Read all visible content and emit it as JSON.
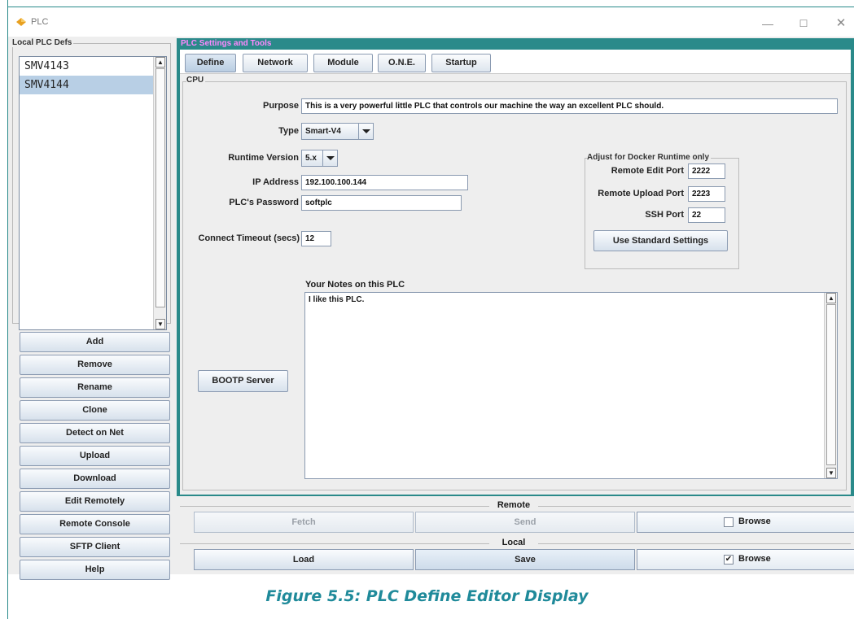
{
  "window": {
    "title": "PLC",
    "icon": "plc-app-icon",
    "controls": {
      "minimize": "—",
      "maximize": "☐",
      "close": "✕"
    }
  },
  "left": {
    "group_title": "Local PLC Defs",
    "plcs": [
      "SMV4143",
      "SMV4144"
    ],
    "selected_index": 1,
    "buttons": [
      "Add",
      "Remove",
      "Rename",
      "Clone",
      "Detect on Net",
      "Upload",
      "Download",
      "Edit Remotely",
      "Remote Console",
      "SFTP Client",
      "Help"
    ]
  },
  "right": {
    "header": "PLC Settings and Tools",
    "tabs": [
      "Define",
      "Network",
      "Module",
      "O.N.E.",
      "Startup"
    ],
    "active_tab": "Define",
    "cpu": {
      "group_title": "CPU",
      "purpose_label": "Purpose",
      "purpose_value": "This is a very powerful little PLC that controls our machine the way an excellent PLC should.",
      "type_label": "Type",
      "type_value": "Smart-V4",
      "runtime_label": "Runtime Version",
      "runtime_value": "5.x",
      "ip_label": "IP Address",
      "ip_value": "192.100.100.144",
      "password_label": "PLC's Password",
      "password_value": "softplc",
      "timeout_label": "Connect Timeout (secs)",
      "timeout_value": "12",
      "docker": {
        "group_title": "Adjust for Docker Runtime only",
        "edit_port_label": "Remote Edit Port",
        "edit_port_value": "2222",
        "upload_port_label": "Remote Upload Port",
        "upload_port_value": "2223",
        "ssh_port_label": "SSH Port",
        "ssh_port_value": "22",
        "standard_button": "Use Standard Settings"
      },
      "bootp_button": "BOOTP Server",
      "notes_label": "Your Notes on this PLC",
      "notes_value": "I like this PLC."
    },
    "remote": {
      "label": "Remote",
      "fetch": "Fetch",
      "send": "Send",
      "browse": "Browse",
      "browse_checked": false
    },
    "local": {
      "label": "Local",
      "load": "Load",
      "save": "Save",
      "browse": "Browse",
      "browse_checked": true
    }
  },
  "caption": "Figure 5.5: PLC Define Editor Display",
  "colors": {
    "accent_teal": "#2a8a8a",
    "header_text": "#ff88ff",
    "selection": "#b8cfe5",
    "caption": "#1f8a9a"
  }
}
